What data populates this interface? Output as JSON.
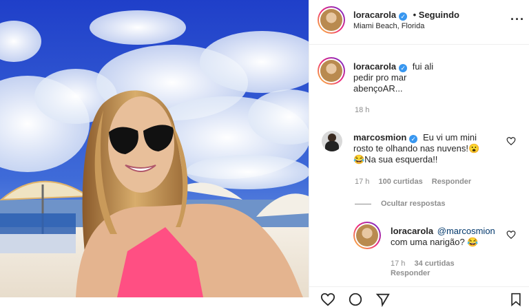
{
  "post": {
    "username": "loracarola",
    "follow_status": "• Seguindo",
    "location": "Miami Beach, Florida",
    "more_icon": "more-horizontal-icon"
  },
  "caption": {
    "username": "loracarola",
    "lines": [
      "fui ali",
      "pedir pro mar",
      "abençoAR..."
    ],
    "time": "18 h"
  },
  "comments": [
    {
      "username": "marcosmion",
      "line1": "Eu vi um mini",
      "line2": "rosto te olhando nas nuvens!😮",
      "line3": "😂Na sua esquerda!!",
      "time": "17 h",
      "likes": "100 curtidas",
      "reply": "Responder"
    }
  ],
  "hide_replies": "Ocultar respostas",
  "reply": {
    "username": "loracarola",
    "mention": "@marcosmion",
    "text": "com uma narigão? 😂",
    "time": "17 h",
    "likes": "34 curtidas",
    "reply": "Responder"
  },
  "colors": {
    "verified": "#3897f0",
    "mention": "#00376b",
    "muted": "#8e8e8e"
  }
}
